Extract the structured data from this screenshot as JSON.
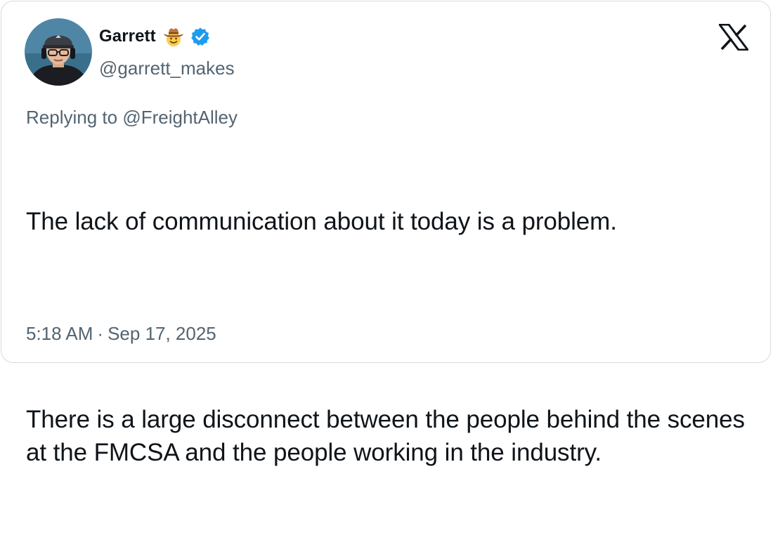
{
  "author": {
    "display_name": "Garrett",
    "handle": "@garrett_makes",
    "emoji_icon": "cowboy-hat-face-emoji",
    "verified_icon": "verified-badge-icon",
    "verified_color": "#1d9bf0"
  },
  "reply": {
    "prefix": "Replying to",
    "mention": "@FreightAlley"
  },
  "tweet": {
    "paragraph_1": "The lack of communication about it today is a problem.",
    "paragraph_2": "There is a large disconnect between the people behind the scenes at the FMCSA and the people working in the industry."
  },
  "meta": {
    "time": "5:18 AM",
    "separator": "·",
    "date": "Sep 17, 2025"
  },
  "colors": {
    "text_primary": "#0f1419",
    "text_secondary": "#536471",
    "border": "#d4dbe1"
  },
  "logo": "x-logo-icon"
}
